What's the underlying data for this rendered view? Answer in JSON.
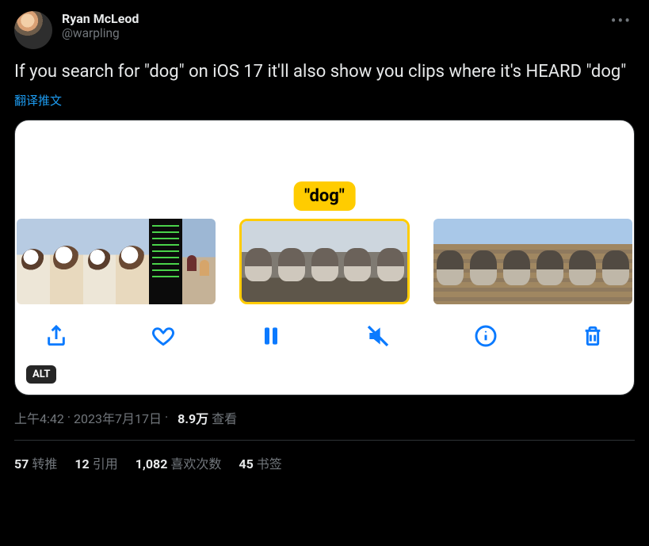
{
  "author": {
    "display_name": "Ryan McLeod",
    "handle": "@warpling"
  },
  "tweet_text": "If you search for \"dog\" on iOS 17 it'll also show you clips where it's HEARD \"dog\"",
  "translate_label": "翻译推文",
  "media": {
    "tag_label": "\"dog\"",
    "alt_badge": "ALT"
  },
  "meta": {
    "time": "上午4:42",
    "date": "2023年7月17日",
    "views_value": "8.9万",
    "views_label": "查看"
  },
  "stats": {
    "retweets": {
      "count": "57",
      "label": "转推"
    },
    "quotes": {
      "count": "12",
      "label": "引用"
    },
    "likes": {
      "count": "1,082",
      "label": "喜欢次数"
    },
    "bookmarks": {
      "count": "45",
      "label": "书签"
    }
  },
  "toolbar_icons": {
    "share": "share-icon",
    "like": "heart-icon",
    "pause": "pause-icon",
    "mute": "mute-icon",
    "info": "info-icon",
    "trash": "trash-icon"
  }
}
